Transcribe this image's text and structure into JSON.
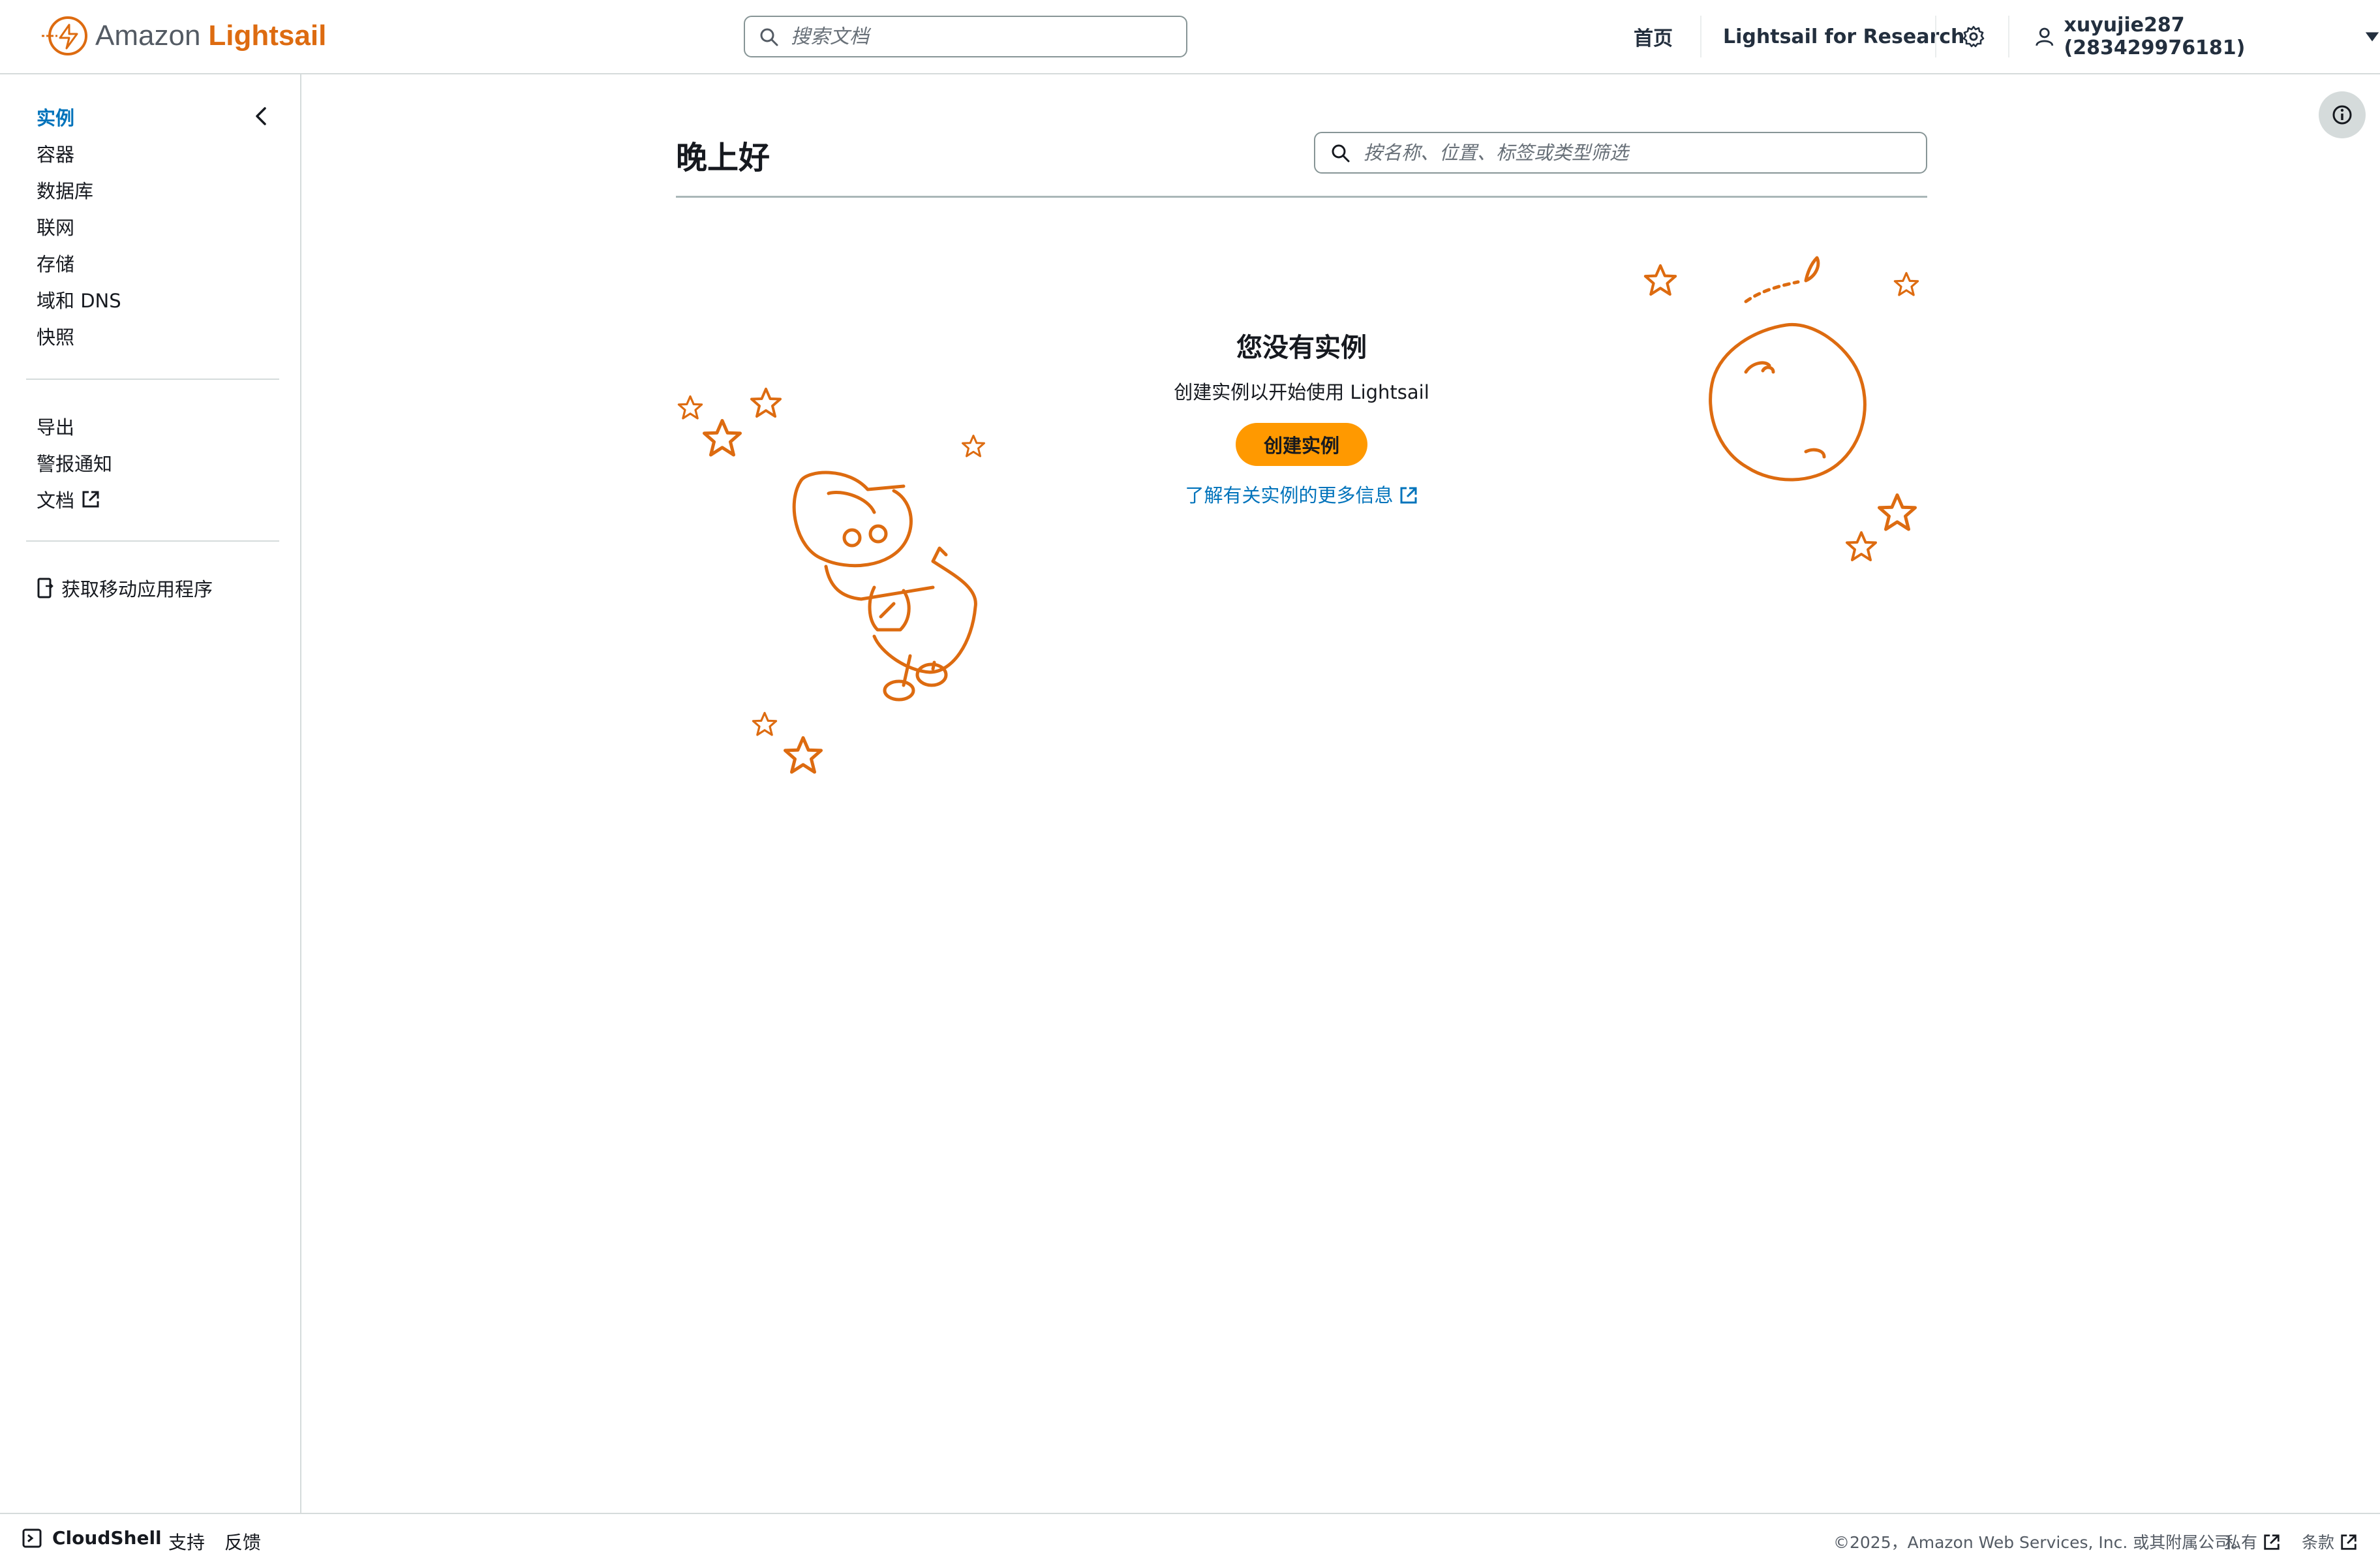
{
  "header": {
    "brand_amazon": "Amazon",
    "brand_lightsail": "Lightsail",
    "search_placeholder": "搜索文档",
    "nav_home": "首页",
    "nav_research": "Lightsail for Research",
    "account": "xuyujie287 (283429976181)"
  },
  "sidebar": {
    "items": [
      "实例",
      "容器",
      "数据库",
      "联网",
      "存储",
      "域和 DNS",
      "快照"
    ],
    "secondary": [
      "导出",
      "警报通知",
      "文档"
    ],
    "mobile_app": "获取移动应用程序"
  },
  "main": {
    "greeting": "晚上好",
    "filter_placeholder": "按名称、位置、标签或类型筛选",
    "empty_title": "您没有实例",
    "empty_subtitle": "创建实例以开始使用 Lightsail",
    "create_button": "创建实例",
    "learn_more": "了解有关实例的更多信息"
  },
  "footer": {
    "cloudshell": "CloudShell",
    "support": "支持",
    "feedback": "反馈",
    "copyright": "©2025，Amazon Web Services, Inc. 或其附属公司。",
    "privacy": "私有",
    "terms": "条款"
  },
  "colors": {
    "accent": "#dd6b10",
    "primary_button": "#ff9900",
    "link": "#0073bb"
  }
}
